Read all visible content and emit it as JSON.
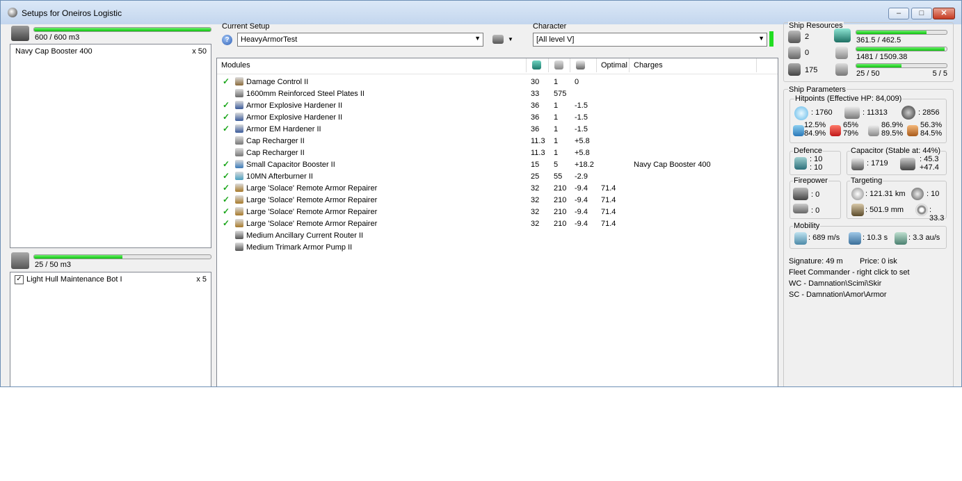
{
  "window": {
    "title": "Setups for Oneiros Logistic",
    "min": "–",
    "max": "□",
    "close": "✕"
  },
  "cargo": {
    "capacity": "600 / 600 m3",
    "fill": 1.0,
    "item": "Navy Cap Booster 400",
    "qty": "x 50"
  },
  "drones": {
    "capacity": "25 / 50 m3",
    "fill": 0.5,
    "item": "Light Hull Maintenance Bot I",
    "qty": "x 5"
  },
  "setup": {
    "label": "Current Setup",
    "value": "HeavyArmorTest",
    "help": "?",
    "arrow": "▼"
  },
  "character": {
    "label": "Character",
    "value": "[All level V]",
    "arrow": "▼"
  },
  "modules": {
    "headers": [
      "Modules",
      "",
      "",
      "",
      "Optimal",
      "Charges"
    ],
    "rows": [
      {
        "ok": true,
        "name": "Damage Control II",
        "cpu": "30",
        "pg": "1",
        "cap": "0",
        "opt": "",
        "charge": ""
      },
      {
        "ok": false,
        "name": "1600mm Reinforced Steel Plates II",
        "cpu": "33",
        "pg": "575",
        "cap": "",
        "opt": "",
        "charge": ""
      },
      {
        "ok": true,
        "name": "Armor Explosive Hardener II",
        "cpu": "36",
        "pg": "1",
        "cap": "-1.5",
        "opt": "",
        "charge": ""
      },
      {
        "ok": true,
        "name": "Armor Explosive Hardener II",
        "cpu": "36",
        "pg": "1",
        "cap": "-1.5",
        "opt": "",
        "charge": ""
      },
      {
        "ok": true,
        "name": "Armor EM Hardener II",
        "cpu": "36",
        "pg": "1",
        "cap": "-1.5",
        "opt": "",
        "charge": ""
      },
      {
        "ok": false,
        "name": "Cap Recharger II",
        "cpu": "11.3",
        "pg": "1",
        "cap": "+5.8",
        "opt": "",
        "charge": ""
      },
      {
        "ok": false,
        "name": "Cap Recharger II",
        "cpu": "11.3",
        "pg": "1",
        "cap": "+5.8",
        "opt": "",
        "charge": ""
      },
      {
        "ok": true,
        "name": "Small Capacitor Booster II",
        "cpu": "15",
        "pg": "5",
        "cap": "+18.2",
        "opt": "",
        "charge": "Navy Cap Booster 400"
      },
      {
        "ok": true,
        "name": "10MN Afterburner II",
        "cpu": "25",
        "pg": "55",
        "cap": "-2.9",
        "opt": "",
        "charge": ""
      },
      {
        "ok": true,
        "name": "Large 'Solace' Remote Armor Repairer",
        "cpu": "32",
        "pg": "210",
        "cap": "-9.4",
        "opt": "71.4",
        "charge": ""
      },
      {
        "ok": true,
        "name": "Large 'Solace' Remote Armor Repairer",
        "cpu": "32",
        "pg": "210",
        "cap": "-9.4",
        "opt": "71.4",
        "charge": ""
      },
      {
        "ok": true,
        "name": "Large 'Solace' Remote Armor Repairer",
        "cpu": "32",
        "pg": "210",
        "cap": "-9.4",
        "opt": "71.4",
        "charge": ""
      },
      {
        "ok": true,
        "name": "Large 'Solace' Remote Armor Repairer",
        "cpu": "32",
        "pg": "210",
        "cap": "-9.4",
        "opt": "71.4",
        "charge": ""
      },
      {
        "ok": false,
        "name": "Medium Ancillary Current Router II",
        "cpu": "",
        "pg": "",
        "cap": "",
        "opt": "",
        "charge": ""
      },
      {
        "ok": false,
        "name": "Medium Trimark Armor Pump II",
        "cpu": "",
        "pg": "",
        "cap": "",
        "opt": "",
        "charge": ""
      }
    ]
  },
  "resources": {
    "label": "Ship Resources",
    "turrets": "2",
    "launchers": "0",
    "calibration": "175",
    "cpu": "361.5 / 462.5",
    "cpu_fill": 0.78,
    "power": "1481 / 1509.38",
    "power_fill": 0.98,
    "drone_bw": "25 / 50",
    "drone_bw_fill": 0.5,
    "drones_active": "5 / 5"
  },
  "params": {
    "label": "Ship Parameters",
    "hp_label": "Hitpoints (Effective HP: 84,009)",
    "shield_hp": ": 1760",
    "armor_hp": ": 11313",
    "hull_hp": ": 2856",
    "res_em_a": "12.5%",
    "res_em_b": "84.9%",
    "res_th_a": "65%",
    "res_th_b": "79%",
    "res_ki_a": "86.9%",
    "res_ki_b": "89.5%",
    "res_ex_a": "56.3%",
    "res_ex_b": "84.5%",
    "defence_label": "Defence",
    "def_a": ": 10",
    "def_b": ": 10",
    "cap_label": "Capacitor (Stable at: 44%)",
    "cap_amount": ": 1719",
    "cap_a": ": 45.3",
    "cap_b": "+47.4",
    "fire_label": "Firepower",
    "fire_a": ": 0",
    "fire_b": ": 0",
    "target_label": "Targeting",
    "target_range": ": 121.31 km",
    "target_count": ": 10",
    "scan_res": ": 501.9 mm",
    "sensor": ": 33.3",
    "mobility_label": "Mobility",
    "speed": ": 689 m/s",
    "align": ": 10.3 s",
    "warp": ": 3.3 au/s",
    "signature": "Signature: 49 m",
    "price": "Price: 0 isk",
    "fleet": "Fleet Commander - right click to set",
    "wc": "WC - Damnation\\Scimi\\Skir",
    "sc": "SC - Damnation\\Amor\\Armor"
  }
}
